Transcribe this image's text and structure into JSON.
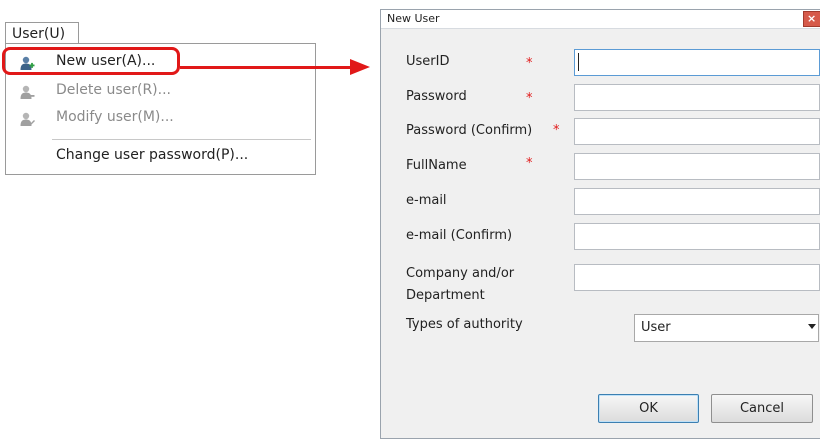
{
  "menu": {
    "title": "User(U)",
    "items": [
      {
        "label": "New user(A)...",
        "icon": "user-add-icon",
        "enabled": true
      },
      {
        "label": "Delete user(R)...",
        "icon": "user-delete-icon",
        "enabled": false
      },
      {
        "label": "Modify user(M)...",
        "icon": "user-edit-icon",
        "enabled": false
      },
      {
        "label": "Change user password(P)...",
        "icon": "",
        "enabled": true
      }
    ]
  },
  "colors": {
    "highlight": "#e11818",
    "required": "#e11818"
  },
  "dialog": {
    "title": "New User",
    "close_glyph": "×",
    "required_mark": "*",
    "fields": [
      {
        "label": "UserID",
        "required": true,
        "value": ""
      },
      {
        "label": "Password",
        "required": true,
        "value": ""
      },
      {
        "label": "Password (Confirm)",
        "required": true,
        "value": ""
      },
      {
        "label": "FullName",
        "required": true,
        "value": ""
      },
      {
        "label": "e-mail",
        "required": false,
        "value": ""
      },
      {
        "label": "e-mail (Confirm)",
        "required": false,
        "value": ""
      },
      {
        "label": "Company and/or\nDepartment",
        "required": false,
        "value": ""
      }
    ],
    "authority": {
      "label": "Types of authority",
      "value": "User"
    },
    "buttons": {
      "ok": "OK",
      "cancel": "Cancel"
    }
  }
}
